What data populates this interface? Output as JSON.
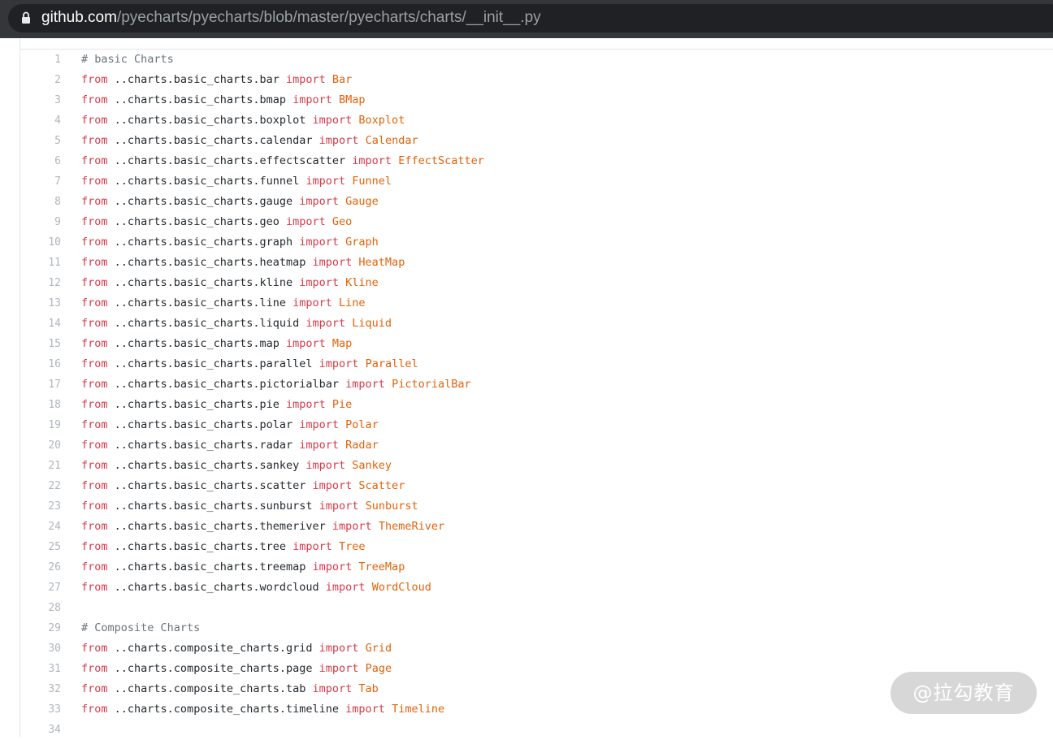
{
  "browser": {
    "url_host": "github.com",
    "url_path": "/pyecharts/pyecharts/blob/master/pyecharts/charts/__init__.py",
    "lock_icon": "lock-icon"
  },
  "code_lines": [
    {
      "n": "1",
      "type": "comment",
      "text": "# basic Charts"
    },
    {
      "n": "2",
      "type": "import",
      "from": "from",
      "module": "..charts.basic_charts.bar",
      "imp": "import",
      "name": "Bar"
    },
    {
      "n": "3",
      "type": "import",
      "from": "from",
      "module": "..charts.basic_charts.bmap",
      "imp": "import",
      "name": "BMap"
    },
    {
      "n": "4",
      "type": "import",
      "from": "from",
      "module": "..charts.basic_charts.boxplot",
      "imp": "import",
      "name": "Boxplot"
    },
    {
      "n": "5",
      "type": "import",
      "from": "from",
      "module": "..charts.basic_charts.calendar",
      "imp": "import",
      "name": "Calendar"
    },
    {
      "n": "6",
      "type": "import",
      "from": "from",
      "module": "..charts.basic_charts.effectscatter",
      "imp": "import",
      "name": "EffectScatter"
    },
    {
      "n": "7",
      "type": "import",
      "from": "from",
      "module": "..charts.basic_charts.funnel",
      "imp": "import",
      "name": "Funnel"
    },
    {
      "n": "8",
      "type": "import",
      "from": "from",
      "module": "..charts.basic_charts.gauge",
      "imp": "import",
      "name": "Gauge"
    },
    {
      "n": "9",
      "type": "import",
      "from": "from",
      "module": "..charts.basic_charts.geo",
      "imp": "import",
      "name": "Geo"
    },
    {
      "n": "10",
      "type": "import",
      "from": "from",
      "module": "..charts.basic_charts.graph",
      "imp": "import",
      "name": "Graph"
    },
    {
      "n": "11",
      "type": "import",
      "from": "from",
      "module": "..charts.basic_charts.heatmap",
      "imp": "import",
      "name": "HeatMap"
    },
    {
      "n": "12",
      "type": "import",
      "from": "from",
      "module": "..charts.basic_charts.kline",
      "imp": "import",
      "name": "Kline"
    },
    {
      "n": "13",
      "type": "import",
      "from": "from",
      "module": "..charts.basic_charts.line",
      "imp": "import",
      "name": "Line"
    },
    {
      "n": "14",
      "type": "import",
      "from": "from",
      "module": "..charts.basic_charts.liquid",
      "imp": "import",
      "name": "Liquid"
    },
    {
      "n": "15",
      "type": "import",
      "from": "from",
      "module": "..charts.basic_charts.map",
      "imp": "import",
      "name": "Map"
    },
    {
      "n": "16",
      "type": "import",
      "from": "from",
      "module": "..charts.basic_charts.parallel",
      "imp": "import",
      "name": "Parallel"
    },
    {
      "n": "17",
      "type": "import",
      "from": "from",
      "module": "..charts.basic_charts.pictorialbar",
      "imp": "import",
      "name": "PictorialBar"
    },
    {
      "n": "18",
      "type": "import",
      "from": "from",
      "module": "..charts.basic_charts.pie",
      "imp": "import",
      "name": "Pie"
    },
    {
      "n": "19",
      "type": "import",
      "from": "from",
      "module": "..charts.basic_charts.polar",
      "imp": "import",
      "name": "Polar"
    },
    {
      "n": "20",
      "type": "import",
      "from": "from",
      "module": "..charts.basic_charts.radar",
      "imp": "import",
      "name": "Radar"
    },
    {
      "n": "21",
      "type": "import",
      "from": "from",
      "module": "..charts.basic_charts.sankey",
      "imp": "import",
      "name": "Sankey"
    },
    {
      "n": "22",
      "type": "import",
      "from": "from",
      "module": "..charts.basic_charts.scatter",
      "imp": "import",
      "name": "Scatter"
    },
    {
      "n": "23",
      "type": "import",
      "from": "from",
      "module": "..charts.basic_charts.sunburst",
      "imp": "import",
      "name": "Sunburst"
    },
    {
      "n": "24",
      "type": "import",
      "from": "from",
      "module": "..charts.basic_charts.themeriver",
      "imp": "import",
      "name": "ThemeRiver"
    },
    {
      "n": "25",
      "type": "import",
      "from": "from",
      "module": "..charts.basic_charts.tree",
      "imp": "import",
      "name": "Tree"
    },
    {
      "n": "26",
      "type": "import",
      "from": "from",
      "module": "..charts.basic_charts.treemap",
      "imp": "import",
      "name": "TreeMap"
    },
    {
      "n": "27",
      "type": "import",
      "from": "from",
      "module": "..charts.basic_charts.wordcloud",
      "imp": "import",
      "name": "WordCloud"
    },
    {
      "n": "28",
      "type": "blank"
    },
    {
      "n": "29",
      "type": "comment",
      "text": "# Composite Charts"
    },
    {
      "n": "30",
      "type": "import",
      "from": "from",
      "module": "..charts.composite_charts.grid",
      "imp": "import",
      "name": "Grid"
    },
    {
      "n": "31",
      "type": "import",
      "from": "from",
      "module": "..charts.composite_charts.page",
      "imp": "import",
      "name": "Page"
    },
    {
      "n": "32",
      "type": "import",
      "from": "from",
      "module": "..charts.composite_charts.tab",
      "imp": "import",
      "name": "Tab"
    },
    {
      "n": "33",
      "type": "import",
      "from": "from",
      "module": "..charts.composite_charts.timeline",
      "imp": "import",
      "name": "Timeline"
    },
    {
      "n": "34",
      "type": "blank"
    }
  ],
  "watermark": "@拉勾教育",
  "colors": {
    "keyword": "#d73a49",
    "class_name": "#e36209",
    "comment": "#6a737d",
    "text": "#24292e"
  }
}
